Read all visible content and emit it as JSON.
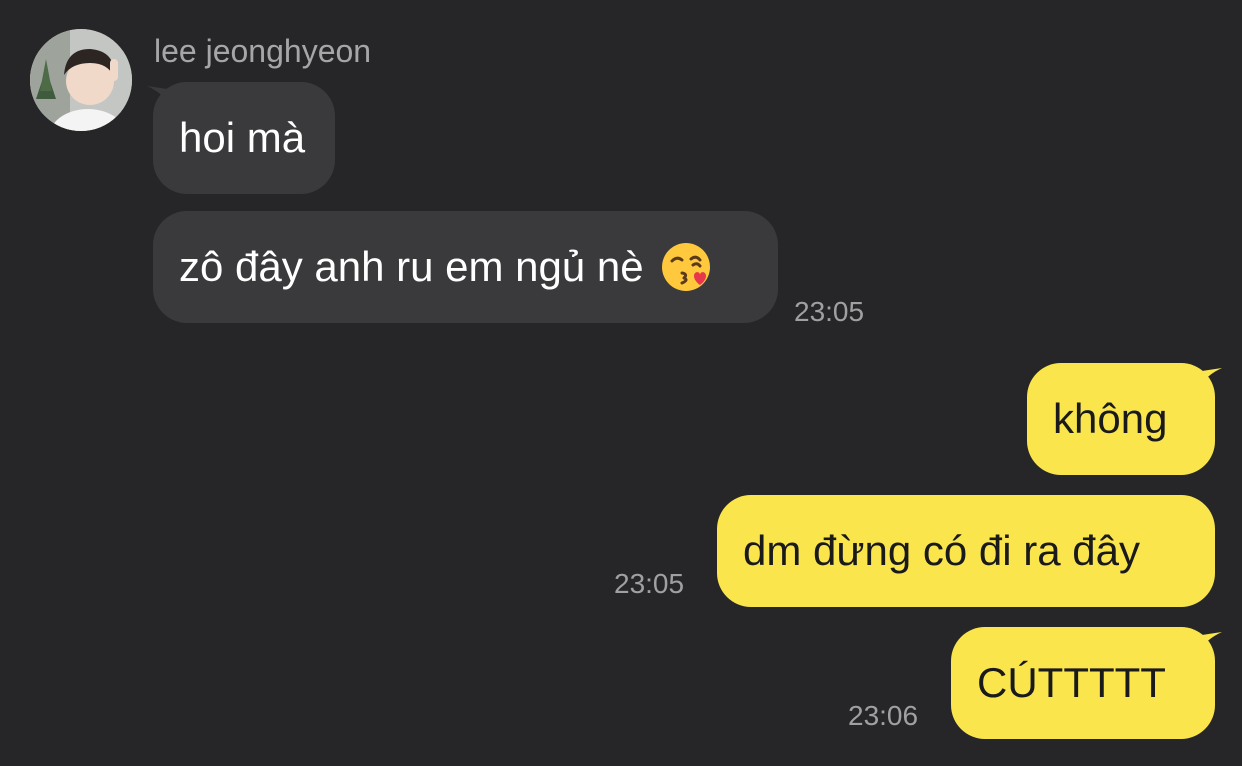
{
  "sender": {
    "name": "lee jeonghyeon",
    "avatar_icon": "profile-photo"
  },
  "messages": [
    {
      "direction": "incoming",
      "text": "hoi mà",
      "time": ""
    },
    {
      "direction": "incoming",
      "text": "zô đây anh ru em ngủ nè",
      "emoji": "kissing-face-heart-emoji",
      "time": "23:05"
    },
    {
      "direction": "outgoing",
      "text": "không",
      "time": ""
    },
    {
      "direction": "outgoing",
      "text": "dm đừng có đi ra đây",
      "time": "23:05"
    },
    {
      "direction": "outgoing",
      "text": "CÚTTTTT",
      "time": "23:06"
    }
  ],
  "colors": {
    "background": "#262628",
    "incoming_bubble": "#3a3a3c",
    "outgoing_bubble": "#fae64c",
    "meta_text": "#a6a6a8"
  }
}
